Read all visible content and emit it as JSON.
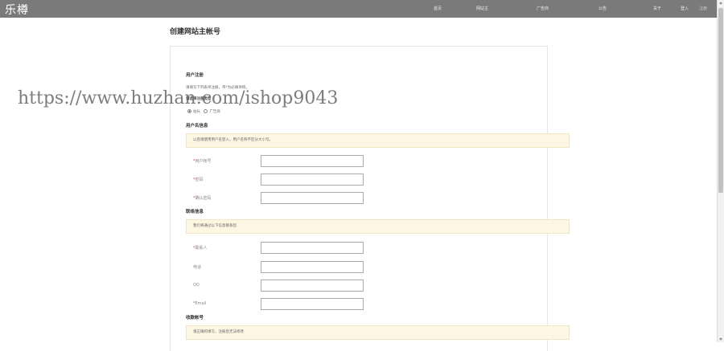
{
  "header": {
    "logo": "乐樽",
    "nav": [
      "首页",
      "网站主",
      "广告商",
      "公告",
      "关于"
    ],
    "login": "登入",
    "register": "注册"
  },
  "page_title": "创建网站主帐号",
  "form": {
    "section_register": "用户注册",
    "register_hint": "请填写下列表单注册，带*为必填项目。",
    "choose_type_label": "请选择注册类型",
    "type_options": [
      "站长",
      "广告商"
    ],
    "section_username": "用户名信息",
    "username_notice": "以后请使用用户名登入，用户名称不区分大小写。",
    "username_label": "用户帐号",
    "password_label": "密码",
    "confirm_password_label": "确认密码",
    "section_contact": "联络信息",
    "contact_notice": "我们将通过以下信息联系您",
    "contact_label": "联系人",
    "phone_label": "电话",
    "qq_label": "QQ",
    "email_label": "Email",
    "section_payment": "收款帐号",
    "payment_notice": "请正确的填写，注册后无法修改"
  },
  "watermark": "https://www.huzhan.com/ishop9043"
}
